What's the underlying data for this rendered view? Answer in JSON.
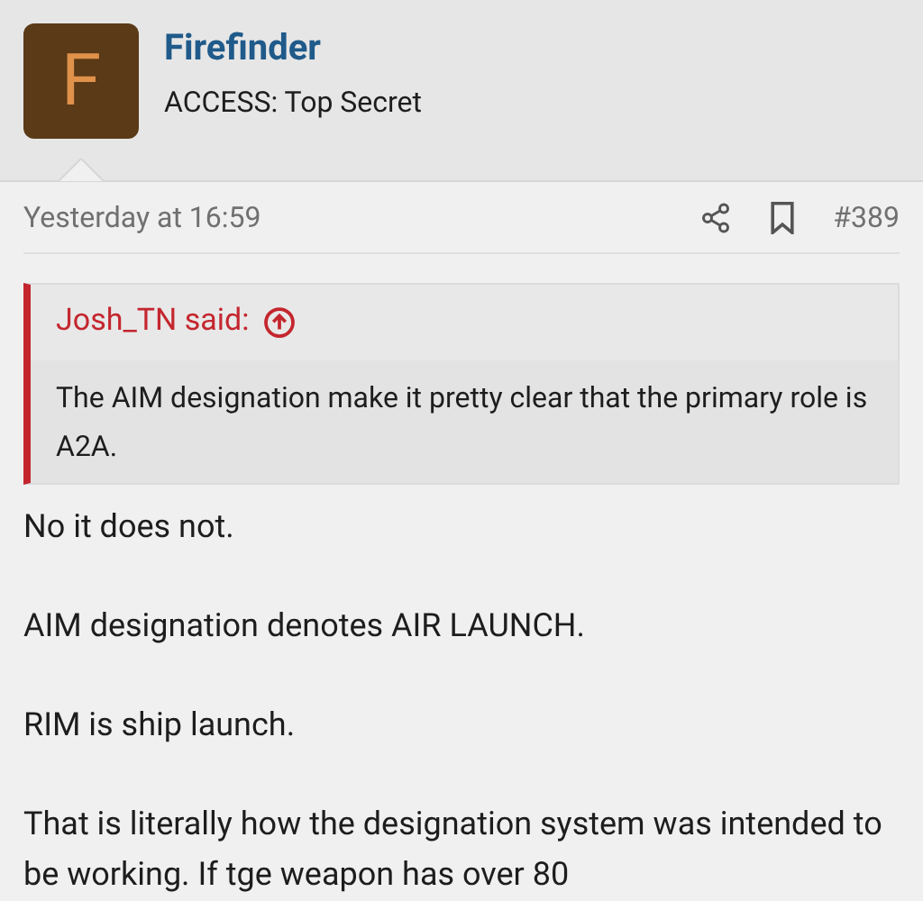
{
  "author": {
    "avatar_letter": "F",
    "name": "Firefinder",
    "title": "ACCESS: Top Secret"
  },
  "post": {
    "time": "Yesterday at 16:59",
    "number": "#389"
  },
  "quote": {
    "attribution": "Josh_TN said:",
    "text": "The AIM designation make it pretty clear that the primary role is A2A."
  },
  "paragraphs": [
    "No it does not.",
    "AIM designation denotes AIR LAUNCH.",
    "RIM is ship launch.",
    "That is literally how the designation system was intended to be working. If tge weapon has over 80"
  ]
}
